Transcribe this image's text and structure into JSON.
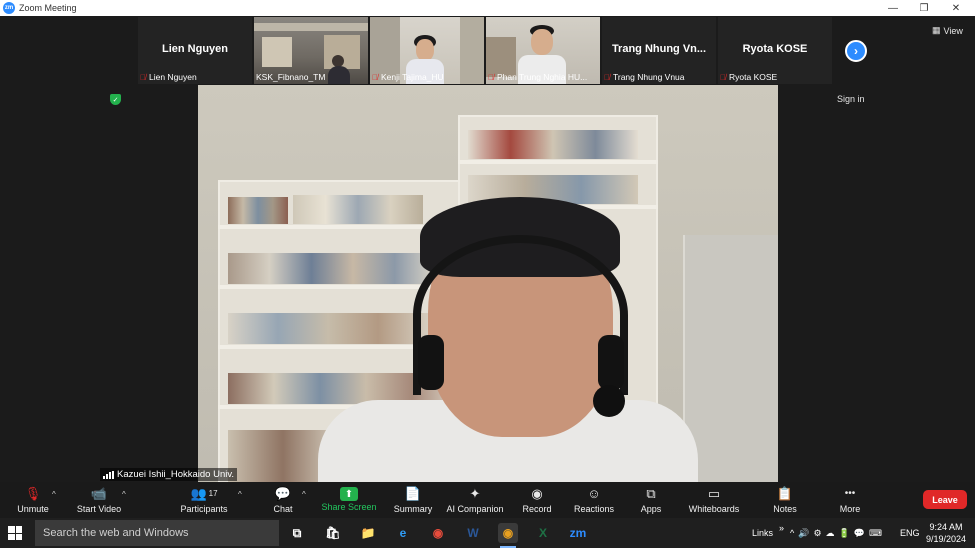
{
  "window": {
    "title": "Zoom Meeting",
    "logo_text": "zm",
    "controls": [
      "—",
      "❐",
      "✕"
    ]
  },
  "gallery": {
    "tiles": [
      {
        "display_name": "Lien Nguyen",
        "name_label": "Lien Nguyen",
        "video": false
      },
      {
        "display_name": "",
        "name_label": "KSK_Fibnano_TM",
        "video": true
      },
      {
        "display_name": "",
        "name_label": "Kenji Tajima_HU",
        "video": true
      },
      {
        "display_name": "",
        "name_label": "Phan Trung Nghia HU...",
        "video": true
      },
      {
        "display_name": "Trang Nhung Vn...",
        "name_label": "Trang Nhung Vnua",
        "video": false
      },
      {
        "display_name": "Ryota KOSE",
        "name_label": "Ryota KOSE",
        "video": false
      }
    ],
    "next_arrow": "›"
  },
  "view_button": {
    "icon": "▦",
    "label": "View"
  },
  "sign_in": "Sign in",
  "main_video": {
    "name_label": "Kazuei Ishii_Hokkaido Univ."
  },
  "toolbar": {
    "unmute": {
      "icon": "🎙",
      "label": "Unmute"
    },
    "start_video": {
      "icon": "📹",
      "label": "Start Video"
    },
    "participants": {
      "icon": "👥",
      "count": "17",
      "label": "Participants"
    },
    "chat": {
      "icon": "💬",
      "label": "Chat"
    },
    "share_screen": {
      "icon": "⬆",
      "label": "Share Screen"
    },
    "summary": {
      "icon": "📄",
      "label": "Summary"
    },
    "ai_companion": {
      "icon": "✦",
      "label": "AI Companion"
    },
    "record": {
      "icon": "◉",
      "label": "Record"
    },
    "reactions": {
      "icon": "☺",
      "label": "Reactions"
    },
    "apps": {
      "icon": "⧉",
      "label": "Apps"
    },
    "whiteboards": {
      "icon": "▭",
      "label": "Whiteboards"
    },
    "notes": {
      "icon": "📋",
      "label": "Notes"
    },
    "more": {
      "icon": "•••",
      "label": "More"
    },
    "leave": "Leave",
    "caret": "^"
  },
  "taskbar": {
    "search_placeholder": "Search the web and Windows",
    "apps": [
      {
        "name": "task-view",
        "glyph": "⧉",
        "color": "#ffffff"
      },
      {
        "name": "store",
        "glyph": "🛍",
        "color": "#ffffff"
      },
      {
        "name": "file-explorer",
        "glyph": "📁",
        "color": "#f4c542"
      },
      {
        "name": "edge",
        "glyph": "e",
        "color": "#2f9bf5"
      },
      {
        "name": "chrome",
        "glyph": "◉",
        "color": "#e74c3c"
      },
      {
        "name": "word",
        "glyph": "W",
        "color": "#2b5797"
      },
      {
        "name": "chrome-profile",
        "glyph": "◉",
        "color": "#e8a020"
      },
      {
        "name": "excel",
        "glyph": "X",
        "color": "#1e7145"
      },
      {
        "name": "zoom",
        "glyph": "zm",
        "color": "#2d8cff"
      }
    ],
    "links_label": "Links",
    "tray_chevron": "»",
    "tray_icons": [
      "^",
      "🔊",
      "⚙",
      "☁",
      "🔋",
      "💬",
      "⌨"
    ],
    "language": "ENG",
    "time": "9:24 AM",
    "date": "9/19/2024"
  }
}
